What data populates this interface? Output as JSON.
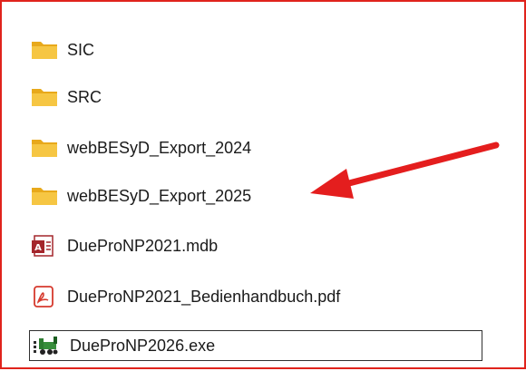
{
  "explorer": {
    "items": [
      {
        "name": "SIC",
        "icon": "folder-icon"
      },
      {
        "name": "SRC",
        "icon": "folder-icon"
      },
      {
        "name": "webBESyD_Export_2024",
        "icon": "folder-icon"
      },
      {
        "name": "webBESyD_Export_2025",
        "icon": "folder-icon"
      },
      {
        "name": "DueProNP2021.mdb",
        "icon": "access-database-icon"
      },
      {
        "name": "DueProNP2021_Bedienhandbuch.pdf",
        "icon": "pdf-icon"
      },
      {
        "name": "DueProNP2026.exe",
        "icon": "application-icon"
      }
    ]
  },
  "colors": {
    "frame_border": "#e0231c",
    "arrow": "#e41e1e",
    "folder": "#f6c643",
    "folder_dark": "#e8a91b"
  }
}
